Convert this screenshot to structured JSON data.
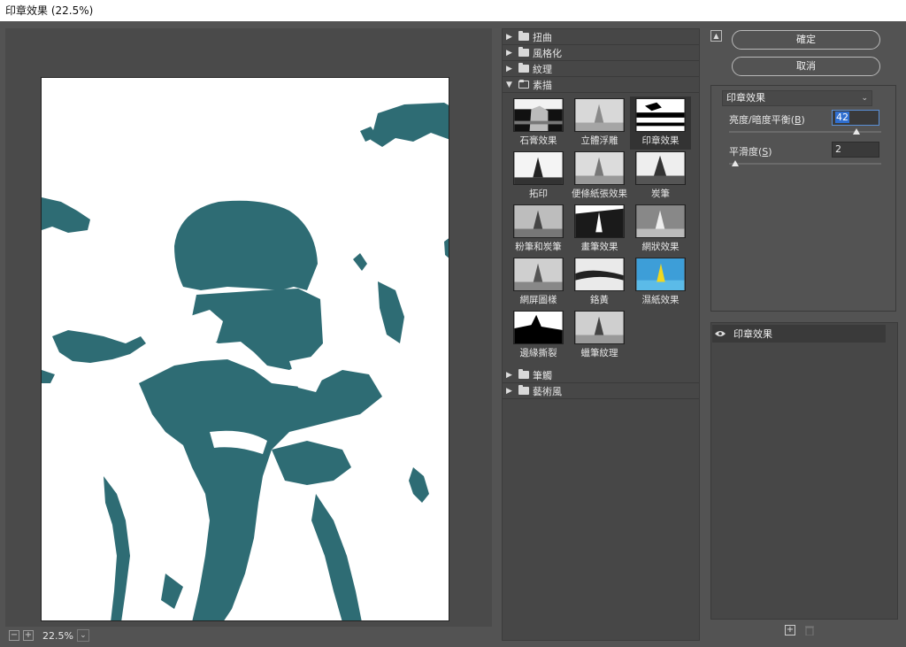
{
  "window": {
    "title": "印章效果 (22.5%)"
  },
  "preview": {
    "zoom": "22.5%",
    "zoom_out": "−",
    "zoom_in": "+",
    "zoom_dropdown": "⌄"
  },
  "gallery": {
    "categories_top": [
      {
        "label": "扭曲",
        "expanded": false
      },
      {
        "label": "風格化",
        "expanded": false
      },
      {
        "label": "紋理",
        "expanded": false
      }
    ],
    "open_category": {
      "label": "素描",
      "expanded": true
    },
    "filters": [
      {
        "label": "石膏效果",
        "selected": false
      },
      {
        "label": "立體浮雕",
        "selected": false
      },
      {
        "label": "印章效果",
        "selected": true
      },
      {
        "label": "拓印",
        "selected": false
      },
      {
        "label": "便條紙張效果",
        "selected": false
      },
      {
        "label": "炭筆",
        "selected": false
      },
      {
        "label": "粉筆和炭筆",
        "selected": false
      },
      {
        "label": "畫筆效果",
        "selected": false
      },
      {
        "label": "網狀效果",
        "selected": false
      },
      {
        "label": "網屏圖樣",
        "selected": false
      },
      {
        "label": "鉻黃",
        "selected": false
      },
      {
        "label": "濕紙效果",
        "selected": false
      },
      {
        "label": "邊緣撕裂",
        "selected": false
      },
      {
        "label": "蠟筆紋理",
        "selected": false
      }
    ],
    "categories_bottom": [
      {
        "label": "筆觸",
        "expanded": false
      },
      {
        "label": "藝術風",
        "expanded": false
      }
    ]
  },
  "buttons": {
    "ok": "確定",
    "cancel": "取消"
  },
  "settings": {
    "filter_select": "印章效果",
    "param1": {
      "label": "亮度/暗度平衡(",
      "mnemonic": "B",
      "suffix": ")",
      "value": "42",
      "max": 50
    },
    "param2": {
      "label": "平滑度(",
      "mnemonic": "S",
      "suffix": ")",
      "value": "2",
      "max": 50
    }
  },
  "layers": {
    "items": [
      {
        "label": "印章效果"
      }
    ]
  },
  "colors": {
    "accent": "#2f6fd1",
    "stamp_ink": "#2e6c74",
    "panel_bg": "#535353"
  }
}
